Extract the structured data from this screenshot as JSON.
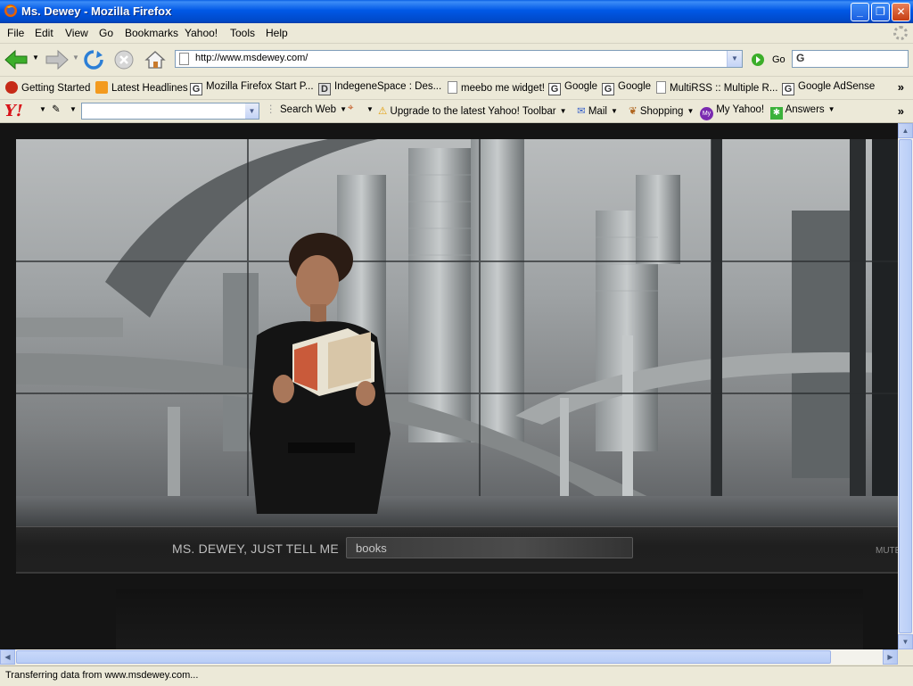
{
  "window": {
    "title": "Ms. Dewey - Mozilla Firefox"
  },
  "menu": [
    "File",
    "Edit",
    "View",
    "Go",
    "Bookmarks",
    "Yahoo!",
    "Tools",
    "Help"
  ],
  "nav": {
    "url": "http://www.msdewey.com/",
    "go_label": "Go"
  },
  "bookmarks": [
    {
      "label": "Getting Started",
      "icon": "firefox-icon"
    },
    {
      "label": "Latest Headlines",
      "icon": "rss-icon"
    },
    {
      "label": "Mozilla Firefox Start P...",
      "icon": "google-icon"
    },
    {
      "label": "IndegeneSpace : Des...",
      "icon": "d-icon"
    },
    {
      "label": "meebo me widget!",
      "icon": "page-icon"
    },
    {
      "label": "Google",
      "icon": "google-icon"
    },
    {
      "label": "Google",
      "icon": "google-icon"
    },
    {
      "label": "MultiRSS :: Multiple R...",
      "icon": "page-icon"
    },
    {
      "label": "Google AdSense",
      "icon": "google-icon"
    }
  ],
  "yahoo_toolbar": {
    "logo": "Y!",
    "search_web": "Search Web",
    "upgrade": "Upgrade to the latest Yahoo! Toolbar",
    "mail": "Mail",
    "shopping": "Shopping",
    "my_yahoo": "My Yahoo!",
    "answers": "Answers"
  },
  "page": {
    "prompt_label": "MS. DEWEY,  JUST TELL ME",
    "query": "books",
    "mute_label": "MUTE"
  },
  "status": {
    "text": "Transferring data from www.msdewey.com..."
  }
}
